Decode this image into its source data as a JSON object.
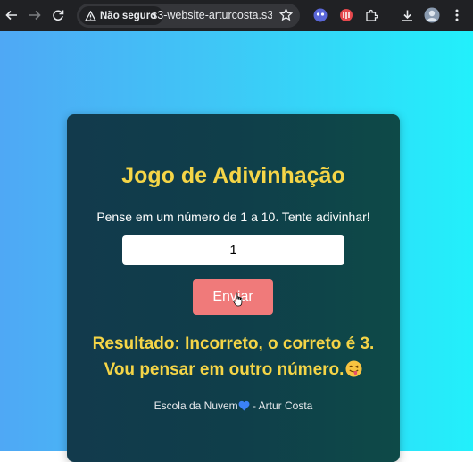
{
  "browser": {
    "security_label": "Não seguro",
    "url": "s3-website-arturcosta.s3-...",
    "icons": [
      "back-arrow-icon",
      "forward-arrow-icon",
      "reload-icon",
      "warning-icon",
      "star-icon",
      "extension-icon",
      "download-icon",
      "avatar"
    ]
  },
  "page": {
    "title": "Jogo de Adivinhação",
    "instructions": "Pense em um número de 1 a 10. Tente adivinhar!",
    "guess_value": "1",
    "submit_label": "Enviar",
    "result_line1": "Resultado: Incorreto, o correto é 3.",
    "result_line2": "Vou pensar em outro número.",
    "footer_left": "Escola da Nuvem",
    "footer_right": " - Artur Costa"
  },
  "colors": {
    "title": "#f5d547",
    "button": "#f07a7a",
    "card": "#0f3d4a"
  }
}
